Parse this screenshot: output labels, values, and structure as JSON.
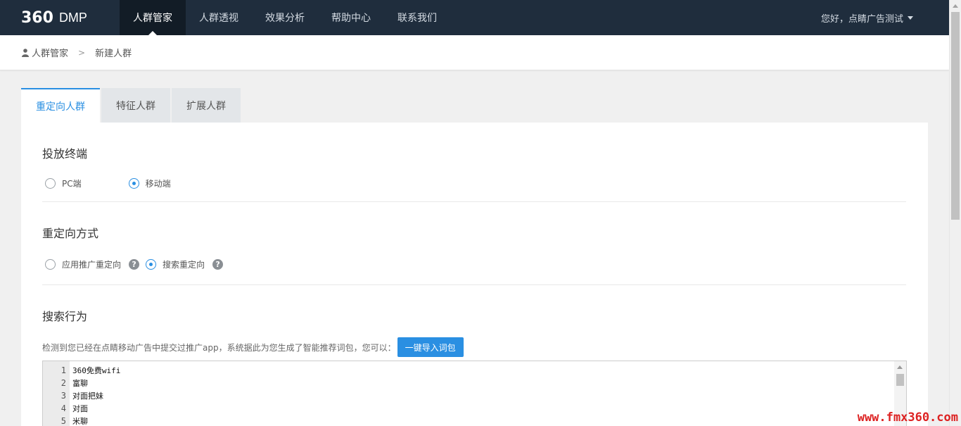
{
  "header": {
    "logo_num": "360",
    "logo_text": "DMP",
    "nav": [
      {
        "label": "人群管家",
        "active": true
      },
      {
        "label": "人群透视"
      },
      {
        "label": "效果分析"
      },
      {
        "label": "帮助中心"
      },
      {
        "label": "联系我们"
      }
    ],
    "user_greeting": "您好，点睛广告测试"
  },
  "breadcrumb": {
    "root": "人群管家",
    "separator": ">",
    "current": "新建人群"
  },
  "tabs": [
    {
      "label": "重定向人群",
      "active": true
    },
    {
      "label": "特征人群"
    },
    {
      "label": "扩展人群"
    }
  ],
  "terminal": {
    "title": "投放终端",
    "options": [
      {
        "label": "PC端",
        "checked": false
      },
      {
        "label": "移动端",
        "checked": true
      }
    ]
  },
  "retarget": {
    "title": "重定向方式",
    "options": [
      {
        "label": "应用推广重定向",
        "checked": false
      },
      {
        "label": "搜索重定向",
        "checked": true
      }
    ],
    "help_glyph": "?"
  },
  "search": {
    "title": "搜索行为",
    "hint": "检测到您已经在点睛移动广告中提交过推广app，系统据此为您生成了智能推荐词包，您可以：",
    "import_button": "一键导入词包",
    "keywords": [
      {
        "n": "1",
        "text": "360免费wifi"
      },
      {
        "n": "2",
        "text": "富聊"
      },
      {
        "n": "3",
        "text": "对面把妹"
      },
      {
        "n": "4",
        "text": "对面"
      },
      {
        "n": "5",
        "text": "米聊"
      }
    ]
  },
  "watermark": "www.fmx360.com",
  "colors": {
    "nav_bg": "#1f2d3d",
    "accent": "#2a8fe2"
  }
}
